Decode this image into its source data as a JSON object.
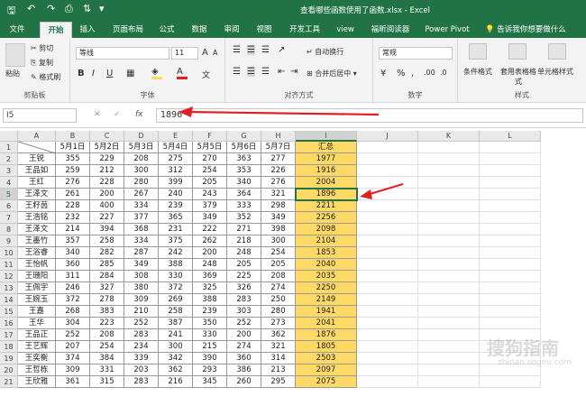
{
  "window": {
    "title": "查看哪些函数使用了函数.xlsx - Excel"
  },
  "tabs": [
    "文件",
    "开始",
    "插入",
    "页面布局",
    "公式",
    "数据",
    "审阅",
    "视图",
    "开发工具",
    "view",
    "福昕阅读器",
    "Power Pivot"
  ],
  "active_tab": "开始",
  "tell_me": "告诉我你想要做什么",
  "ribbon": {
    "clipboard": {
      "paste": "粘贴",
      "cut": "剪切",
      "copy": "复制",
      "format_painter": "格式刷",
      "label": "剪贴板"
    },
    "font": {
      "name": "等线",
      "size": "11",
      "grow": "A",
      "shrink": "A",
      "bold": "B",
      "italic": "I",
      "underline": "U",
      "label": "字体"
    },
    "alignment": {
      "wrap": "自动换行",
      "merge": "合并后居中",
      "label": "对齐方式"
    },
    "number": {
      "format": "常规",
      "percent": "%",
      "comma": ",",
      "label": "数字"
    },
    "styles": {
      "conditional": "条件格式",
      "table": "套用表格格式",
      "cell_style": "单元格样式",
      "label": "样式"
    }
  },
  "formula_bar": {
    "name_box": "I5",
    "cancel": "✕",
    "enter": "✓",
    "fx": "fx",
    "value": "1896"
  },
  "columns": [
    "A",
    "B",
    "C",
    "D",
    "E",
    "F",
    "G",
    "H",
    "I",
    "J",
    "K",
    "L"
  ],
  "rows": [
    1,
    2,
    3,
    4,
    5,
    6,
    7,
    8,
    9,
    10,
    11,
    12,
    13,
    14,
    15,
    16,
    17,
    18,
    19,
    20,
    21
  ],
  "table": {
    "header": [
      "",
      "5月1日",
      "5月2日",
      "5月3日",
      "5月4日",
      "5月5日",
      "5月6日",
      "5月7日",
      "汇总"
    ],
    "data": [
      [
        "王锐",
        "355",
        "229",
        "208",
        "275",
        "270",
        "363",
        "277",
        "1977"
      ],
      [
        "王品如",
        "259",
        "212",
        "300",
        "312",
        "254",
        "353",
        "226",
        "1916"
      ],
      [
        "王红",
        "276",
        "228",
        "280",
        "399",
        "205",
        "340",
        "276",
        "2004"
      ],
      [
        "王泽文",
        "261",
        "200",
        "267",
        "240",
        "243",
        "364",
        "321",
        "1896"
      ],
      [
        "王籽茵",
        "228",
        "400",
        "334",
        "239",
        "379",
        "333",
        "298",
        "2211"
      ],
      [
        "王浩铭",
        "232",
        "227",
        "377",
        "365",
        "349",
        "352",
        "349",
        "2256"
      ],
      [
        "王泽文",
        "214",
        "394",
        "368",
        "231",
        "222",
        "271",
        "398",
        "2098"
      ],
      [
        "王墨竹",
        "357",
        "258",
        "334",
        "375",
        "262",
        "218",
        "300",
        "2104"
      ],
      [
        "王浴睿",
        "340",
        "282",
        "287",
        "242",
        "200",
        "248",
        "254",
        "1853"
      ],
      [
        "王怡帆",
        "360",
        "285",
        "349",
        "388",
        "248",
        "205",
        "205",
        "2040"
      ],
      [
        "王珊阳",
        "311",
        "284",
        "308",
        "330",
        "369",
        "225",
        "208",
        "2035"
      ],
      [
        "王佩宇",
        "246",
        "327",
        "380",
        "372",
        "325",
        "326",
        "274",
        "2250"
      ],
      [
        "王婉玉",
        "372",
        "278",
        "309",
        "269",
        "388",
        "283",
        "250",
        "2149"
      ],
      [
        "王嘉",
        "268",
        "383",
        "210",
        "258",
        "239",
        "303",
        "280",
        "1941"
      ],
      [
        "王华",
        "304",
        "223",
        "252",
        "387",
        "350",
        "252",
        "273",
        "2041"
      ],
      [
        "王品正",
        "252",
        "208",
        "283",
        "241",
        "330",
        "200",
        "362",
        "1876"
      ],
      [
        "王艺辉",
        "207",
        "254",
        "234",
        "300",
        "215",
        "274",
        "321",
        "1805"
      ],
      [
        "王奕衡",
        "374",
        "384",
        "339",
        "342",
        "390",
        "360",
        "314",
        "2503"
      ],
      [
        "王哲栋",
        "309",
        "331",
        "203",
        "362",
        "293",
        "386",
        "213",
        "2097"
      ],
      [
        "王欣雅",
        "361",
        "315",
        "283",
        "216",
        "345",
        "260",
        "295",
        "2075"
      ]
    ]
  },
  "watermark": {
    "main": "搜狗指南",
    "sub": "zhinan.sogou.com"
  },
  "colors": {
    "excel_green": "#217346",
    "total_fill": "#ffd966",
    "arrow": "#e02020"
  }
}
